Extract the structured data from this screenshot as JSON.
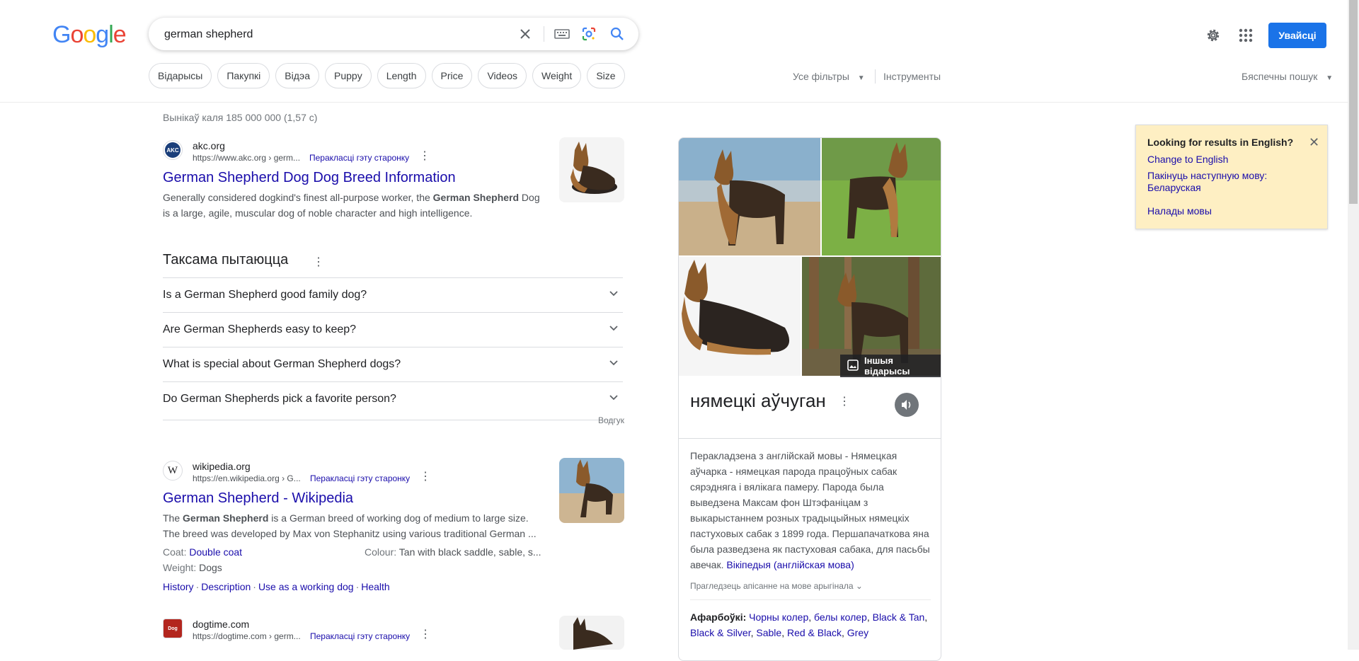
{
  "logo": {
    "text": "Google",
    "letters": [
      "G",
      "o",
      "o",
      "g",
      "l",
      "e"
    ],
    "colors": [
      "#4285f4",
      "#ea4335",
      "#fbbc05",
      "#4285f4",
      "#34a853",
      "#ea4335"
    ]
  },
  "search": {
    "query": "german shepherd"
  },
  "header": {
    "signin_label": "Увайсці"
  },
  "chips": [
    "Відарысы",
    "Пакупкі",
    "Відэа",
    "Puppy",
    "Length",
    "Price",
    "Videos",
    "Weight",
    "Size"
  ],
  "filters": {
    "all_filters": "Усе фільтры",
    "tools": "Інструменты",
    "safesearch": "Бяспечны пошук"
  },
  "stats": "Вынікаў каля 185 000 000 (1,57 с)",
  "results": [
    {
      "site": "akc.org",
      "url": "https://www.akc.org › germ...",
      "translate": "Перакласці гэту старонку",
      "title": "German Shepherd Dog Dog Breed Information",
      "snippet_parts": [
        "Generally considered dogkind's finest all-purpose worker, the ",
        "German Shepherd",
        " Dog is a large, agile, muscular dog of noble character and high intelligence."
      ]
    },
    {
      "site": "wikipedia.org",
      "url": "https://en.wikipedia.org › G...",
      "translate": "Перакласці гэту старонку",
      "title": "German Shepherd - Wikipedia",
      "snippet_parts": [
        "The ",
        "German Shepherd",
        " is a German breed of working dog of medium to large size. The breed was developed by Max von Stephanitz using various traditional German ..."
      ],
      "attributes": {
        "coat_label": "Coat:",
        "coat_value": "Double coat",
        "colour_label": "Colour:",
        "colour_value": "Tan with black saddle, sable, s...",
        "weight_label": "Weight:",
        "weight_value": "Dogs"
      },
      "sitelinks": [
        "History",
        "Description",
        "Use as a working dog",
        "Health"
      ]
    },
    {
      "site": "dogtime.com",
      "url": "https://dogtime.com › germ...",
      "translate": "Перакласці гэту старонку"
    }
  ],
  "paa": {
    "title": "Таксама пытаюцца",
    "questions": [
      "Is a German Shepherd good family dog?",
      "Are German Shepherds easy to keep?",
      "What is special about German Shepherd dogs?",
      "Do German Shepherds pick a favorite person?"
    ],
    "feedback": "Водгук"
  },
  "knowledge_panel": {
    "more_images": "Іншыя відарысы",
    "title": "нямецкі аўчуган",
    "description": "Перакладзена з англійскай мовы - Нямецкая аўчарка - нямецкая парода працоўных сабак сярэдняга і вялікага памеру. Парода была выведзена Максам фон Штэфаніцам з выкарыстаннем розных традыцыйных нямецкіх пастуховых сабак з 1899 года. Першапачаткова яна была разведзена як пастуховая сабака, для пасьбы авечак.",
    "source_link": "Вікіпедыя (англійская мова)",
    "original_toggle": "Прагледзець апісанне на мове арыгінала",
    "colors_label": "Афарбоўкі:",
    "colors": [
      "Чорны колер",
      "белы колер",
      "Black & Tan",
      "Black & Silver",
      "Sable",
      "Red & Black",
      "Grey"
    ]
  },
  "language_notice": {
    "title": "Looking for results in English?",
    "change": "Change to English",
    "keep": "Пакінуць наступную мову: Беларуская",
    "settings": "Налады мовы"
  }
}
